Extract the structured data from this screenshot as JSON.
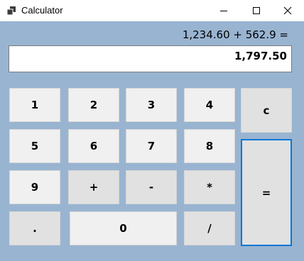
{
  "window": {
    "title": "Calculator"
  },
  "calculator": {
    "expression": "1,234.60 + 562.9 =",
    "display_value": "1,797.50",
    "buttons": {
      "one": "1",
      "two": "2",
      "three": "3",
      "four": "4",
      "five": "5",
      "six": "6",
      "seven": "7",
      "eight": "8",
      "nine": "9",
      "zero": "0",
      "decimal": ".",
      "plus": "+",
      "minus": "-",
      "multiply": "*",
      "divide": "/",
      "clear": "c",
      "equals": "="
    }
  },
  "colors": {
    "window_background": "#99b4d1",
    "button": "#f0f0f0",
    "button_dim": "#e1e1e1",
    "focus_border": "#0078d7"
  },
  "icons": {
    "app": "calculator-app-icon",
    "minimize": "minimize-icon",
    "maximize": "maximize-icon",
    "close": "close-icon"
  }
}
